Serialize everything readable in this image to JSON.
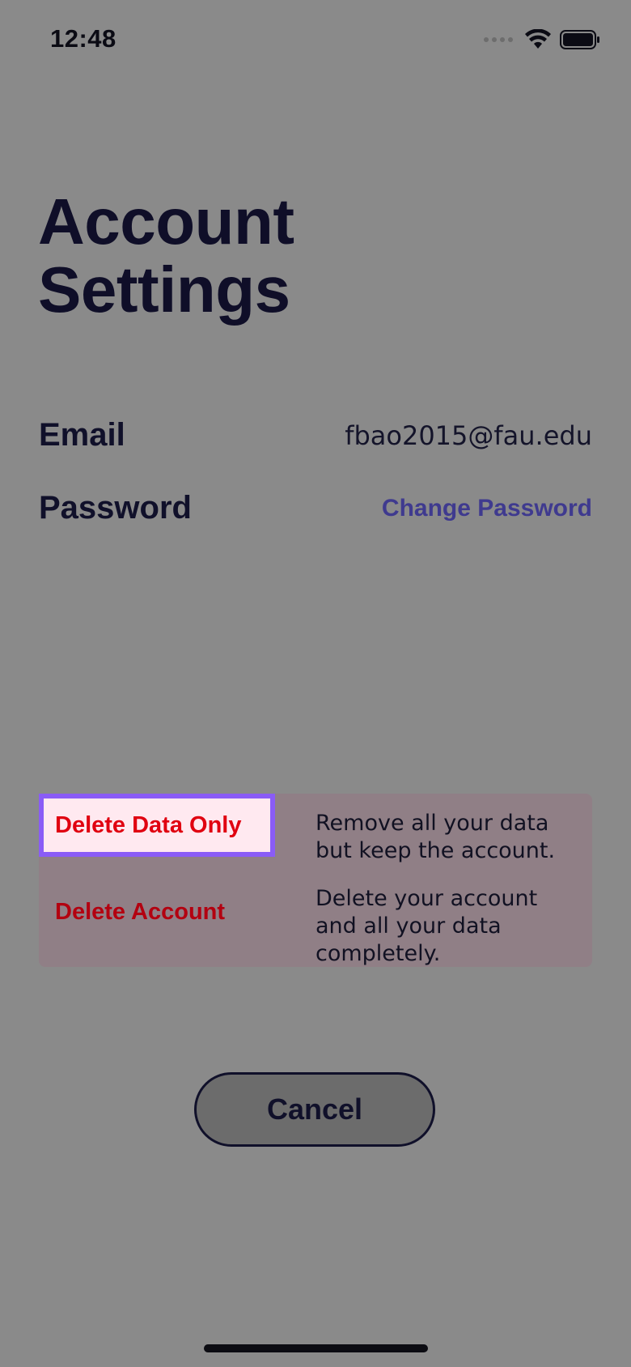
{
  "status_bar": {
    "time": "12:48",
    "icons": [
      "cellular-signal-icon",
      "wifi-icon",
      "battery-icon"
    ]
  },
  "page": {
    "title": "Account Settings"
  },
  "account": {
    "email_label": "Email",
    "email_value": "fbao2015@fau.edu",
    "password_label": "Password",
    "change_password_label": "Change Password"
  },
  "danger_zone": {
    "items": [
      {
        "label": "Delete Data Only",
        "description": "Remove all your data but keep the account.",
        "highlighted": true
      },
      {
        "label": "Delete Account",
        "description": "Delete your account and all your data completely.",
        "highlighted": false
      }
    ]
  },
  "footer": {
    "cancel_label": "Cancel"
  },
  "colors": {
    "background": "#8a8a8a",
    "title": "#0f0e28",
    "link": "#3f3a8f",
    "danger_text": "#e00010",
    "highlight_border": "#8a5cf6",
    "danger_panel": "#907f86"
  }
}
